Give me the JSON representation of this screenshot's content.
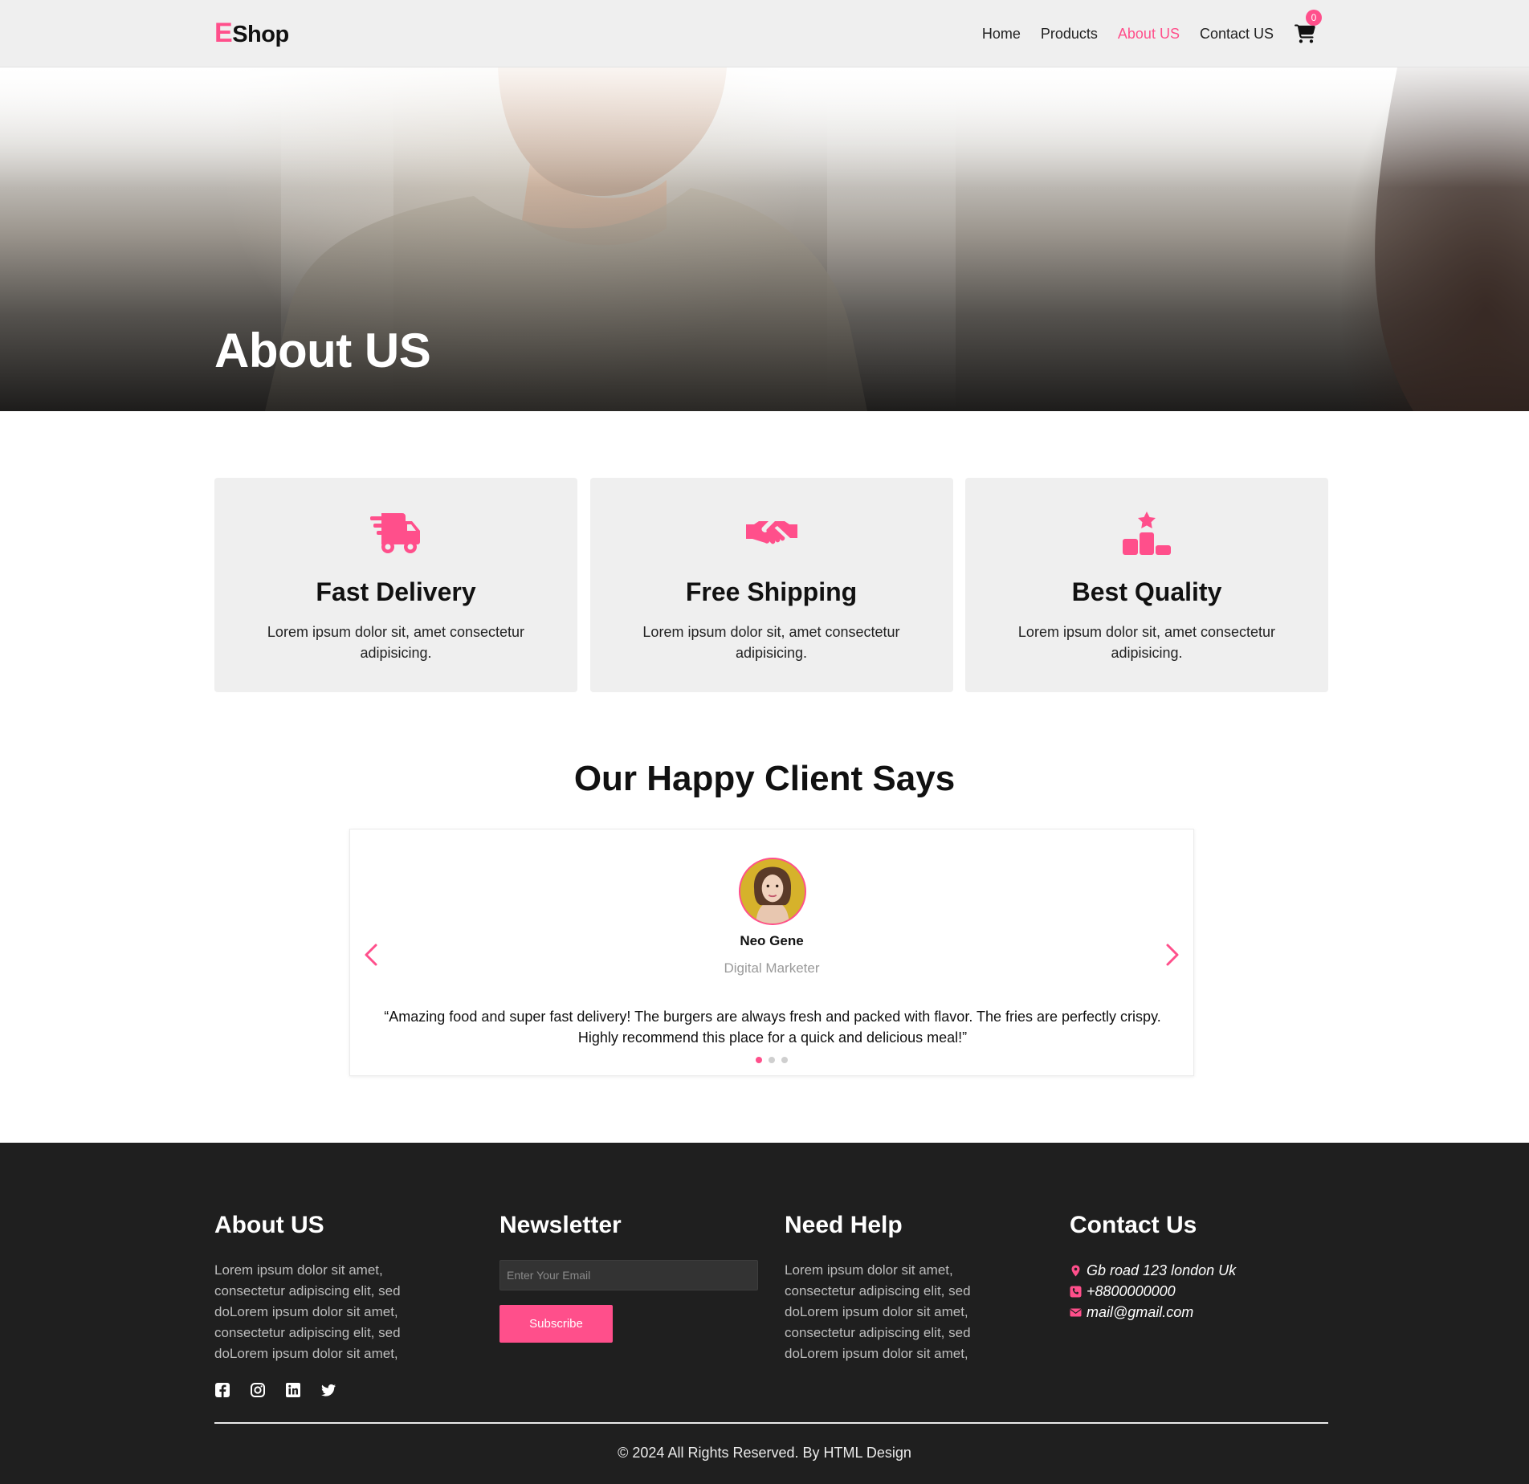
{
  "nav": {
    "brand_first": "E",
    "brand_rest": "Shop",
    "links": [
      "Home",
      "Products",
      "About US",
      "Contact US"
    ],
    "active_link": "About US",
    "cart_count": "0"
  },
  "hero": {
    "title": "About US"
  },
  "features": [
    {
      "icon": "truck-fast-icon",
      "title": "Fast Delivery",
      "text": "Lorem ipsum dolor sit, amet consectetur adipisicing."
    },
    {
      "icon": "handshake-icon",
      "title": "Free Shipping",
      "text": "Lorem ipsum dolor sit, amet consectetur adipisicing."
    },
    {
      "icon": "ranking-star-icon",
      "title": "Best Quality",
      "text": "Lorem ipsum dolor sit, amet consectetur adipisicing."
    }
  ],
  "testimonials": {
    "title": "Our Happy Client Says",
    "name": "Neo Gene",
    "role": "Digital Marketer",
    "quote": "“Amazing food and super fast delivery! The burgers are always fresh and packed with flavor. The fries are perfectly crispy. Highly recommend this place for a quick and delicious meal!”",
    "slide_count": 3,
    "active_slide": 1
  },
  "footer": {
    "about": {
      "title": "About US",
      "text": "Lorem ipsum dolor sit amet, consectetur adipiscing elit, sed doLorem ipsum dolor sit amet, consectetur adipiscing elit, sed doLorem ipsum dolor sit amet,"
    },
    "social": [
      "facebook-icon",
      "instagram-icon",
      "linkedin-icon",
      "twitter-icon"
    ],
    "newsletter": {
      "title": "Newsletter",
      "placeholder": "Enter Your Email",
      "button": "Subscribe"
    },
    "help": {
      "title": "Need Help",
      "text": "Lorem ipsum dolor sit amet, consectetur adipiscing elit, sed doLorem ipsum dolor sit amet, consectetur adipiscing elit, sed doLorem ipsum dolor sit amet,"
    },
    "contact": {
      "title": "Contact Us",
      "address": "Gb road 123 london Uk",
      "phone": "+8800000000",
      "email": "mail@gmail.com"
    },
    "copyright": "© 2024 All Rights Reserved. By HTML Design"
  },
  "colors": {
    "accent": "#ff4f8b",
    "footer_bg": "#1f1f1f",
    "card_bg": "#efefef"
  }
}
